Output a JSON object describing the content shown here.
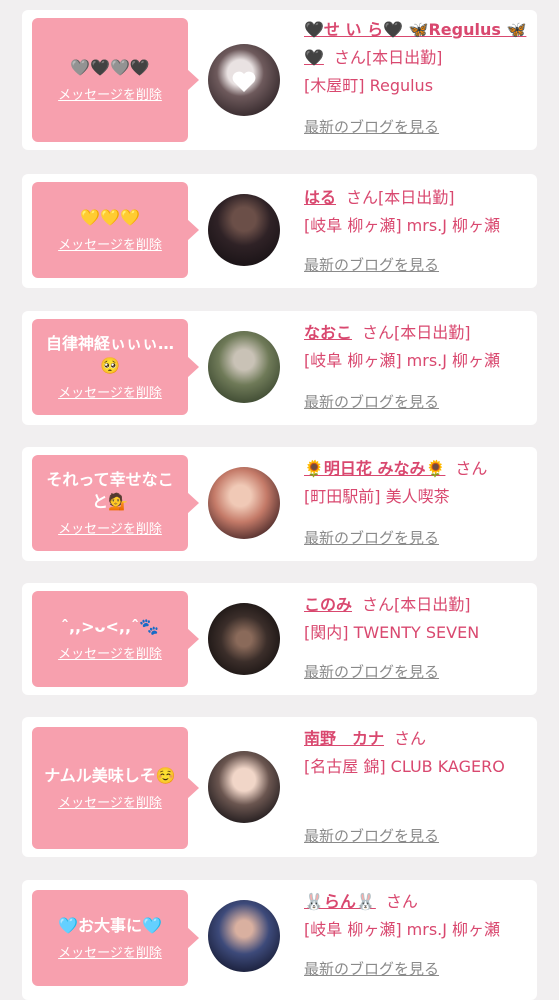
{
  "colors": {
    "background": "#f1eff0",
    "card": "#ffffff",
    "bubble": "#f7a0ae",
    "accent": "#d9486f",
    "link_gray": "#8a8a8a"
  },
  "common": {
    "delete_label": "メッセージを削除",
    "blog_label": "最新のブログを見る",
    "san": "さん"
  },
  "cards": [
    {
      "message": "🩶🖤🩶🖤",
      "name": "🖤せ い ら🖤 🦋Regulus 🦋🖤",
      "status": "[本日出勤]",
      "shop": "[木屋町] Regulus"
    },
    {
      "message": "💛💛💛",
      "name": "はる",
      "status": "[本日出勤]",
      "shop": "[岐阜 柳ヶ瀬] mrs.J 柳ヶ瀬"
    },
    {
      "message": "自律神経ぃぃぃ…🥺",
      "name": "なおこ",
      "status": "[本日出勤]",
      "shop": "[岐阜 柳ヶ瀬] mrs.J 柳ヶ瀬"
    },
    {
      "message": "それって幸せなこと💁",
      "name": "🌻明日花 みなみ🌻",
      "status": "",
      "shop": "[町田駅前] 美人喫茶"
    },
    {
      "message": "ˆ,,>ᴗ<,,ˆ🐾",
      "name": "このみ",
      "status": "[本日出勤]",
      "shop": "[関内] TWENTY SEVEN"
    },
    {
      "message": "ナムル美味しそ☺️",
      "name": "南野　カナ",
      "status": "",
      "shop": "[名古屋 錦] CLUB KAGERO"
    },
    {
      "message": "🩵お大事に🩵",
      "name": "🐰らん🐰",
      "status": "",
      "shop": "[岐阜 柳ヶ瀬] mrs.J 柳ヶ瀬"
    }
  ]
}
